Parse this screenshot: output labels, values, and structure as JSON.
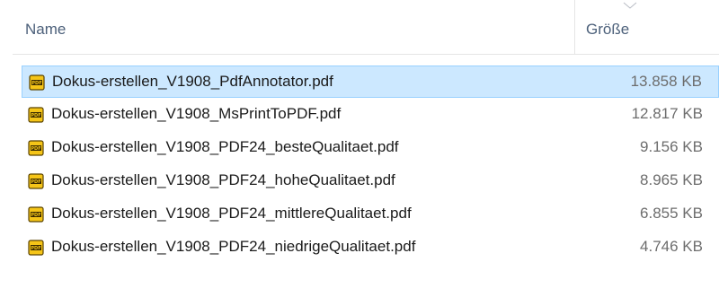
{
  "header": {
    "name_label": "Name",
    "size_label": "Größe",
    "sort_icon": "chevron-down-icon"
  },
  "colors": {
    "selection_bg": "#cce8ff",
    "selection_border": "#99d1ff",
    "header_text": "#4c607a",
    "size_text": "#6d6d6d"
  },
  "files": [
    {
      "name": "Dokus-erstellen_V1908_PdfAnnotator.pdf",
      "size": "13.858 KB",
      "icon": "pdf-icon",
      "selected": true
    },
    {
      "name": "Dokus-erstellen_V1908_MsPrintToPDF.pdf",
      "size": "12.817 KB",
      "icon": "pdf-icon",
      "selected": false
    },
    {
      "name": "Dokus-erstellen_V1908_PDF24_besteQualitaet.pdf",
      "size": "9.156 KB",
      "icon": "pdf-icon",
      "selected": false
    },
    {
      "name": "Dokus-erstellen_V1908_PDF24_hoheQualitaet.pdf",
      "size": "8.965 KB",
      "icon": "pdf-icon",
      "selected": false
    },
    {
      "name": "Dokus-erstellen_V1908_PDF24_mittlereQualitaet.pdf",
      "size": "6.855 KB",
      "icon": "pdf-icon",
      "selected": false
    },
    {
      "name": "Dokus-erstellen_V1908_PDF24_niedrigeQualitaet.pdf",
      "size": "4.746 KB",
      "icon": "pdf-icon",
      "selected": false
    }
  ]
}
